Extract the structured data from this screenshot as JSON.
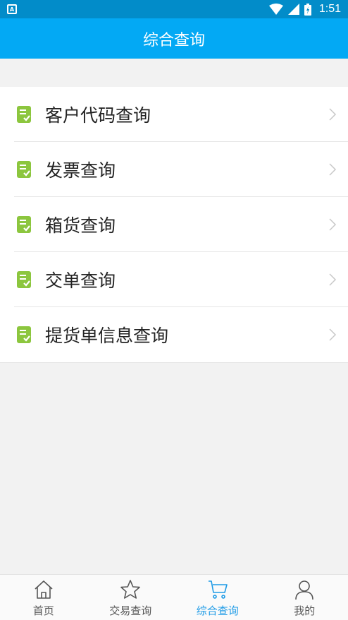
{
  "status_bar": {
    "time": "1:51",
    "notification_icon": "A",
    "icons": [
      "wifi-icon",
      "signal-icon",
      "battery-icon"
    ]
  },
  "header": {
    "title": "综合查询"
  },
  "menu": {
    "items": [
      {
        "label": "客户代码查询",
        "icon": "document-check-icon"
      },
      {
        "label": "发票查询",
        "icon": "document-check-icon"
      },
      {
        "label": "箱货查询",
        "icon": "document-check-icon"
      },
      {
        "label": "交单查询",
        "icon": "document-check-icon"
      },
      {
        "label": "提货单信息查询",
        "icon": "document-check-icon"
      }
    ]
  },
  "tabbar": {
    "active_index": 2,
    "tabs": [
      {
        "label": "首页",
        "icon": "home-icon"
      },
      {
        "label": "交易查询",
        "icon": "star-icon"
      },
      {
        "label": "综合查询",
        "icon": "cart-icon"
      },
      {
        "label": "我的",
        "icon": "user-icon"
      }
    ]
  },
  "colors": {
    "status_bar": "#028cc9",
    "header": "#03a9f4",
    "icon_green": "#8cc63e",
    "tab_active": "#1e9be6",
    "tab_inactive": "#555555"
  }
}
